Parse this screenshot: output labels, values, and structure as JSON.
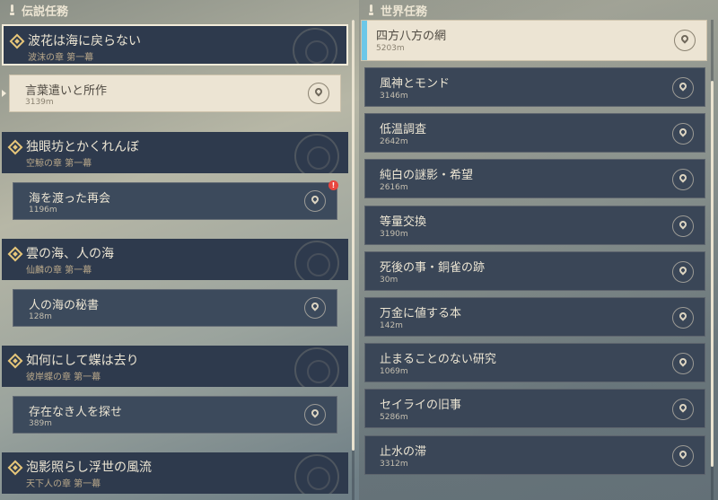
{
  "legend": {
    "header": "伝説任務",
    "groups": [
      {
        "name": "波花は海に戻らない",
        "chapter": "波沫の章 第一幕",
        "step": {
          "name": "言葉遣いと所作",
          "distance": "3139m"
        }
      },
      {
        "name": "独眼坊とかくれんぼ",
        "chapter": "空鯨の章 第一幕",
        "step": {
          "name": "海を渡った再会",
          "distance": "1196m"
        },
        "badge": "!"
      },
      {
        "name": "雲の海、人の海",
        "chapter": "仙麟の章 第一幕",
        "step": {
          "name": "人の海の秘書",
          "distance": "128m"
        }
      },
      {
        "name": "如何にして蝶は去り",
        "chapter": "彼岸蝶の章 第一幕",
        "step": {
          "name": "存在なき人を探せ",
          "distance": "389m"
        }
      },
      {
        "name": "泡影照らし浮世の風流",
        "chapter": "天下人の章 第一幕"
      }
    ]
  },
  "world": {
    "header": "世界任務",
    "quests": [
      {
        "name": "四方八方の網",
        "distance": "5203m"
      },
      {
        "name": "風神とモンド",
        "distance": "3146m"
      },
      {
        "name": "低温調査",
        "distance": "2642m"
      },
      {
        "name": "純白の謎影・希望",
        "distance": "2616m"
      },
      {
        "name": "等量交換",
        "distance": "3190m"
      },
      {
        "name": "死後の事・銅雀の跡",
        "distance": "30m"
      },
      {
        "name": "万金に値する本",
        "distance": "142m"
      },
      {
        "name": "止まることのない研究",
        "distance": "1069m"
      },
      {
        "name": "セイライの旧事",
        "distance": "5286m"
      },
      {
        "name": "止水の滞",
        "distance": "3312m"
      }
    ]
  },
  "colors": {
    "panel_dark": "#2e3a4d",
    "selected_light": "#ece4d3",
    "accent_blue": "#6cc7e8",
    "quest_gold": "#e6c67a",
    "notify_red": "#e8463f"
  },
  "icons": {
    "header": "exclamation-icon",
    "legend_quest": "legend-diamond-icon",
    "navigate": "map-pin-icon"
  }
}
